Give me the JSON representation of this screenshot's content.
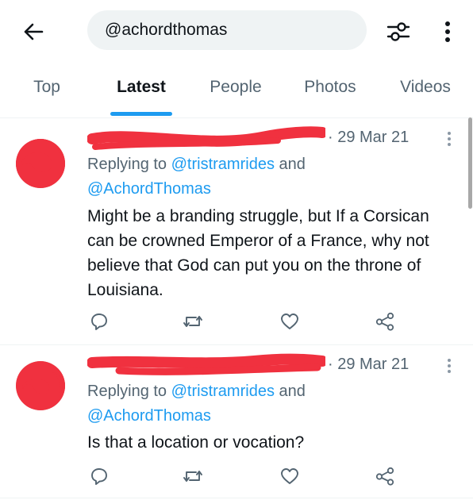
{
  "search": {
    "query": "@achordthomas"
  },
  "tabs": [
    {
      "label": "Top"
    },
    {
      "label": "Latest"
    },
    {
      "label": "People"
    },
    {
      "label": "Photos"
    },
    {
      "label": "Videos"
    }
  ],
  "active_tab": "Latest",
  "tweets": [
    {
      "timestamp": "· 29 Mar 21",
      "replying_prefix": "Replying to ",
      "reply_to_1": "@tristramrides",
      "and": " and",
      "reply_to_2": "@AchordThomas",
      "text": "Might be a branding struggle, but If a Corsican can be crowned Emperor of a France, why not believe that God can put you on the throne of Louisiana."
    },
    {
      "timestamp": "· 29 Mar 21",
      "replying_prefix": "Replying to ",
      "reply_to_1": "@tristramrides",
      "and": " and",
      "reply_to_2": "@AchordThomas",
      "text": "Is that a location or vocation?"
    }
  ],
  "colors": {
    "accent": "#1d9bf0",
    "secondary_text": "#536471",
    "redaction": "#f0313f"
  },
  "icons": {
    "back": "arrow-left-icon",
    "filter": "sliders-icon",
    "more": "vertical-dots-icon",
    "reply": "speech-bubble-icon",
    "retweet": "retweet-icon",
    "like": "heart-icon",
    "share": "share-nodes-icon"
  }
}
